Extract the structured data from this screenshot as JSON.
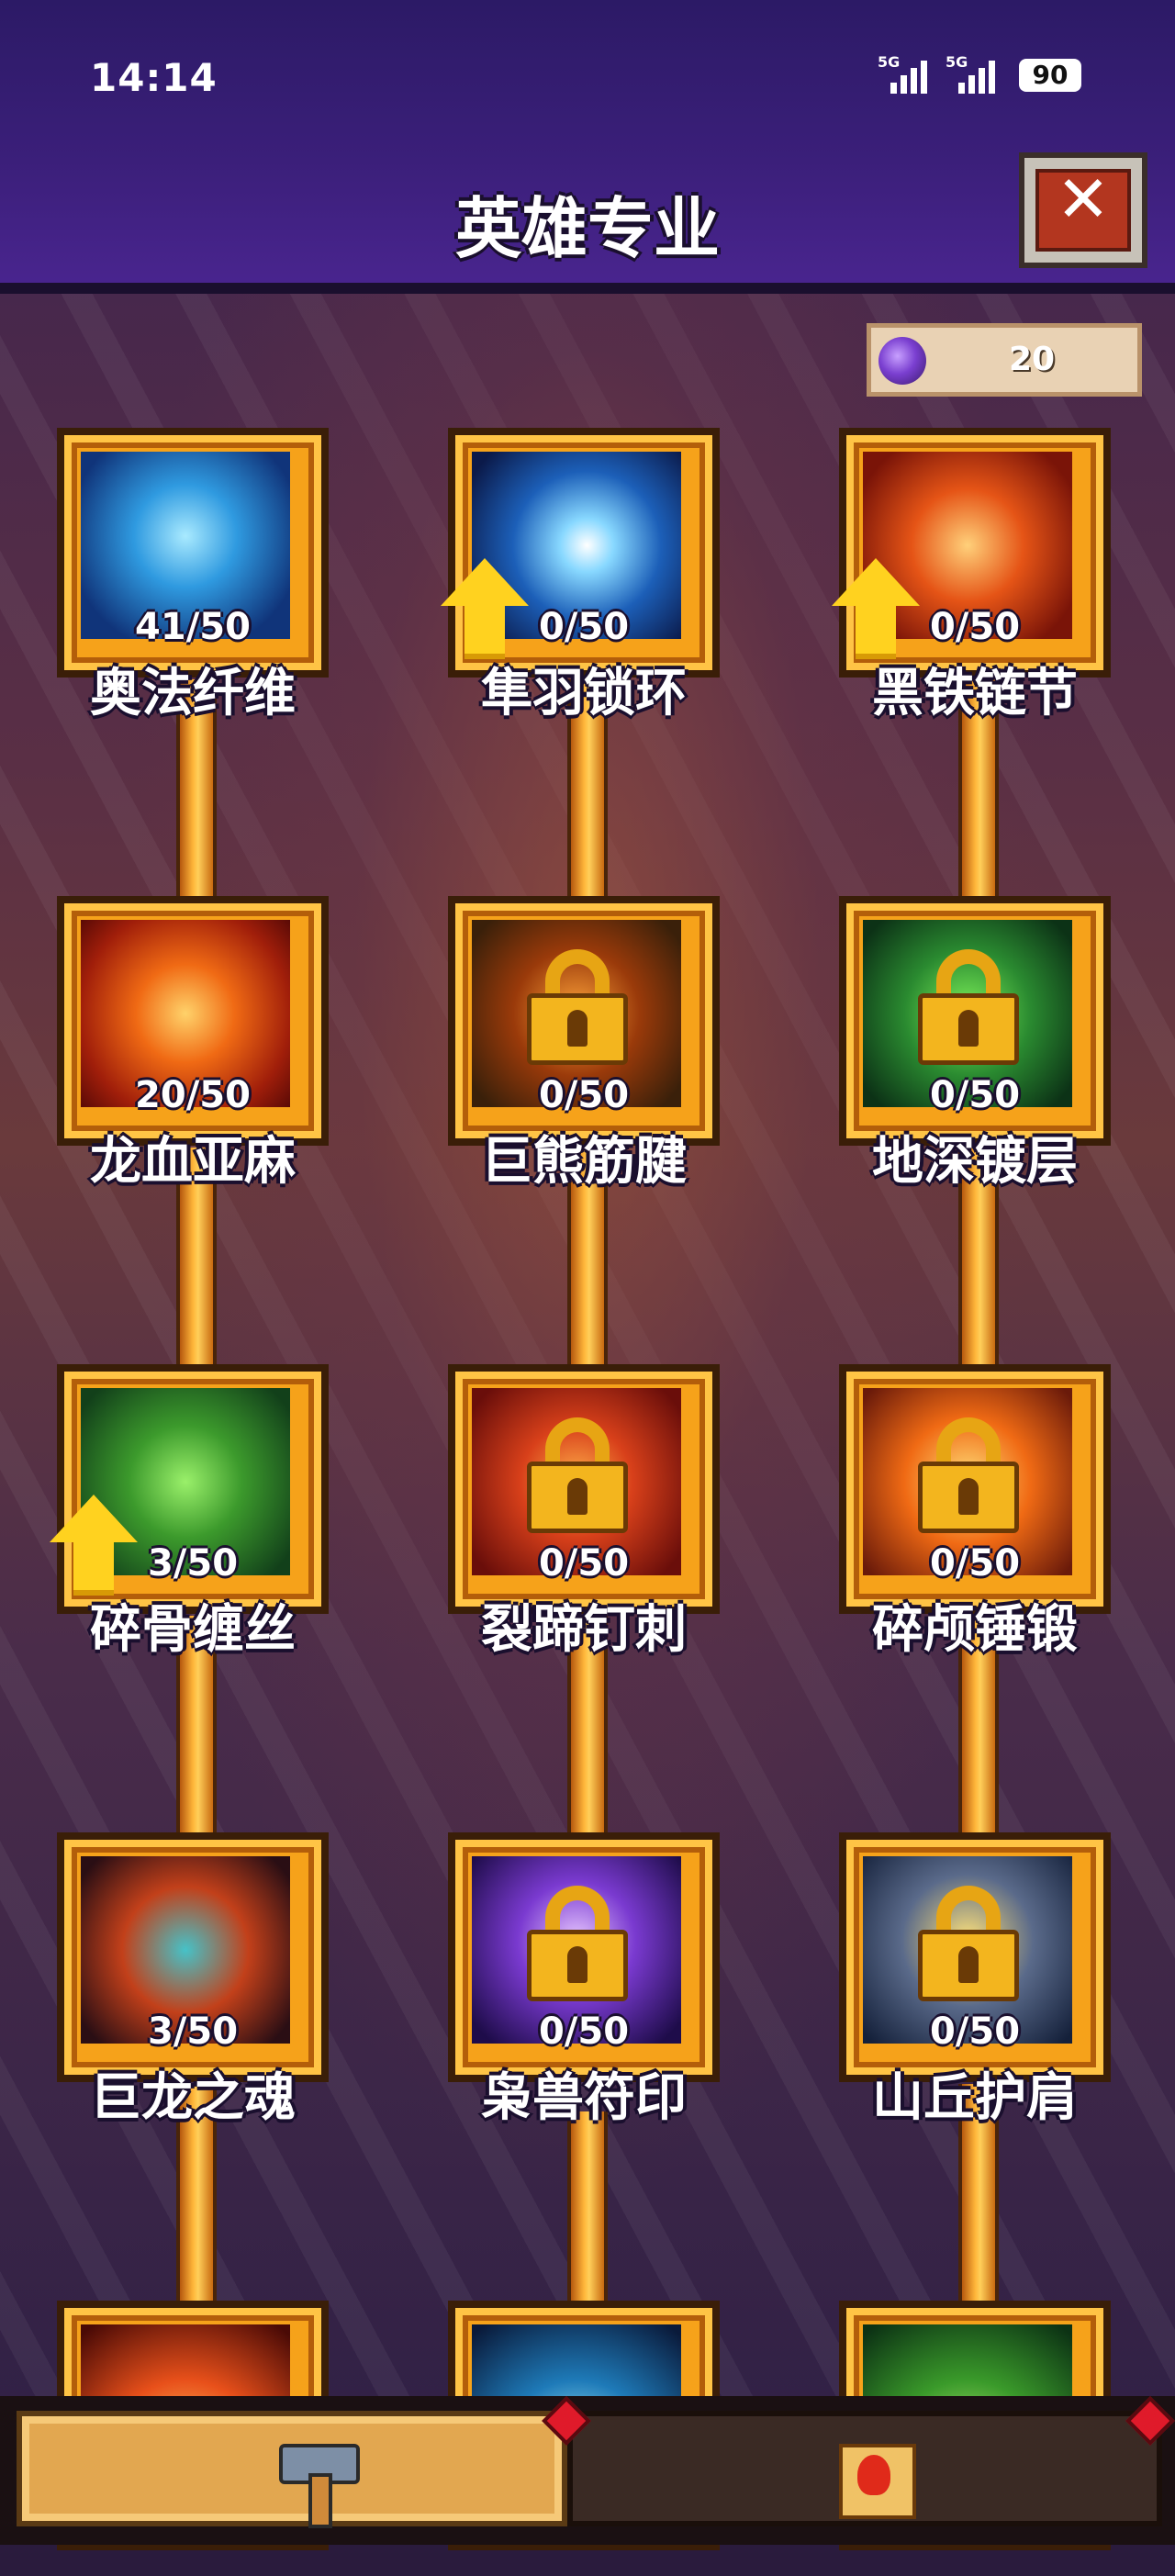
{
  "status_bar": {
    "time": "14:14",
    "network_1": "5G",
    "network_2": "5G",
    "battery": "90"
  },
  "header": {
    "title": "英雄专业",
    "close_icon": "close-icon"
  },
  "currency": {
    "icon": "purple-orb-icon",
    "value": "20"
  },
  "skills": [
    {
      "name": "奥法纤维",
      "progress": "41/50",
      "locked": false,
      "upgrade": false
    },
    {
      "name": "隼羽锁环",
      "progress": "0/50",
      "locked": false,
      "upgrade": true
    },
    {
      "name": "黑铁链节",
      "progress": "0/50",
      "locked": false,
      "upgrade": true
    },
    {
      "name": "龙血亚麻",
      "progress": "20/50",
      "locked": false,
      "upgrade": false
    },
    {
      "name": "巨熊筋腱",
      "progress": "0/50",
      "locked": true,
      "upgrade": false
    },
    {
      "name": "地深镀层",
      "progress": "0/50",
      "locked": true,
      "upgrade": false
    },
    {
      "name": "碎骨缠丝",
      "progress": "3/50",
      "locked": false,
      "upgrade": true
    },
    {
      "name": "裂蹄钉刺",
      "progress": "0/50",
      "locked": true,
      "upgrade": false
    },
    {
      "name": "碎颅锤锻",
      "progress": "0/50",
      "locked": true,
      "upgrade": false
    },
    {
      "name": "巨龙之魂",
      "progress": "3/50",
      "locked": false,
      "upgrade": false
    },
    {
      "name": "枭兽符印",
      "progress": "0/50",
      "locked": true,
      "upgrade": false
    },
    {
      "name": "山丘护肩",
      "progress": "0/50",
      "locked": true,
      "upgrade": false
    }
  ],
  "bottom_nav": {
    "tabs": [
      {
        "icon": "hammer-icon",
        "active": true
      },
      {
        "icon": "scroll-icon",
        "active": false
      }
    ]
  },
  "colors": {
    "frame_gold": "#f6a21a",
    "header_purple": "#3b1f7a",
    "upgrade_arrow": "#ffd21f"
  }
}
